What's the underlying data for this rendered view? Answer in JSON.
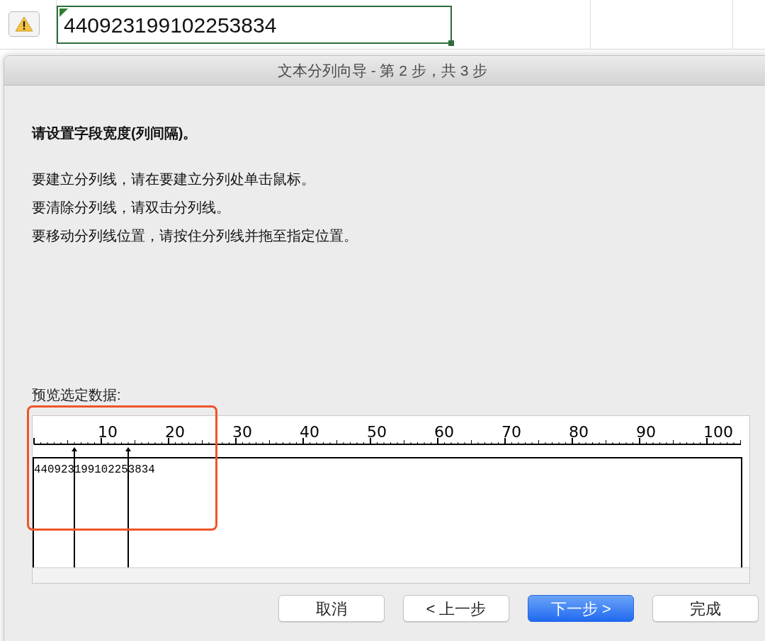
{
  "sheet": {
    "cell_value": "440923199102253834"
  },
  "dialog": {
    "title": "文本分列向导 - 第 2 步，共 3 步",
    "heading": "请设置字段宽度(列间隔)。",
    "instructions": [
      "要建立分列线，请在要建立分列处单击鼠标。",
      "要清除分列线，请双击分列线。",
      "要移动分列线位置，请按住分列线并拖至指定位置。"
    ],
    "preview_label": "预览选定数据:",
    "preview": {
      "ruler_labels": [
        "10",
        "20",
        "30",
        "40",
        "50",
        "60",
        "70",
        "80",
        "90",
        "100"
      ],
      "rows": [
        "440923199102253834"
      ],
      "column_breaks": [
        {
          "level": 0.06
        },
        {
          "level": 0.14
        }
      ]
    },
    "buttons": [
      {
        "label": "取消",
        "primary": false
      },
      {
        "label": "< 上一步",
        "primary": false
      },
      {
        "label": "下一步 >",
        "primary": true
      },
      {
        "label": "完成",
        "primary": false
      }
    ]
  }
}
